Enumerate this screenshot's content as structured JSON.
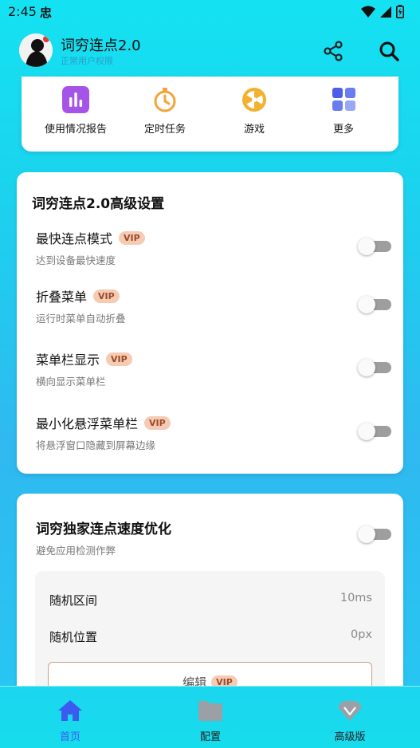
{
  "status": {
    "time": "2:45",
    "app_icon_text": "忠"
  },
  "header": {
    "title": "词穷连点2.0",
    "subtitle": "正常用户权限"
  },
  "quick_actions": [
    {
      "label": "使用情况报告",
      "icon": "bar-chart-icon"
    },
    {
      "label": "定时任务",
      "icon": "stopwatch-icon"
    },
    {
      "label": "游戏",
      "icon": "game-wheel-icon"
    },
    {
      "label": "更多",
      "icon": "grid-icon"
    }
  ],
  "advanced": {
    "title": "词穷连点2.0高级设置",
    "items": [
      {
        "name": "最快连点模式",
        "badge": "VIP",
        "desc": "达到设备最快速度",
        "enabled": false
      },
      {
        "name": "折叠菜单",
        "badge": "VIP",
        "desc": "运行时菜单自动折叠",
        "enabled": false
      },
      {
        "name": "菜单栏显示",
        "badge": "VIP",
        "desc": "横向显示菜单栏",
        "enabled": false
      },
      {
        "name": "最小化悬浮菜单栏",
        "badge": "VIP",
        "desc": "将悬浮窗口隐藏到屏幕边缘",
        "enabled": false
      }
    ]
  },
  "speed": {
    "title": "词穷独家连点速度优化",
    "desc": "避免应用检测作弊",
    "enabled": false,
    "params": [
      {
        "label": "随机区间",
        "value": "10ms"
      },
      {
        "label": "随机位置",
        "value": "0px"
      }
    ],
    "edit_label": "编辑",
    "edit_badge": "VIP"
  },
  "nav": [
    {
      "label": "首页",
      "active": true
    },
    {
      "label": "配置",
      "active": false
    },
    {
      "label": "高级版",
      "active": false
    }
  ],
  "colors": {
    "accent": "#3b5bf0",
    "inactive": "#9aa0a6",
    "vip_bg": "#f6cbb3"
  }
}
